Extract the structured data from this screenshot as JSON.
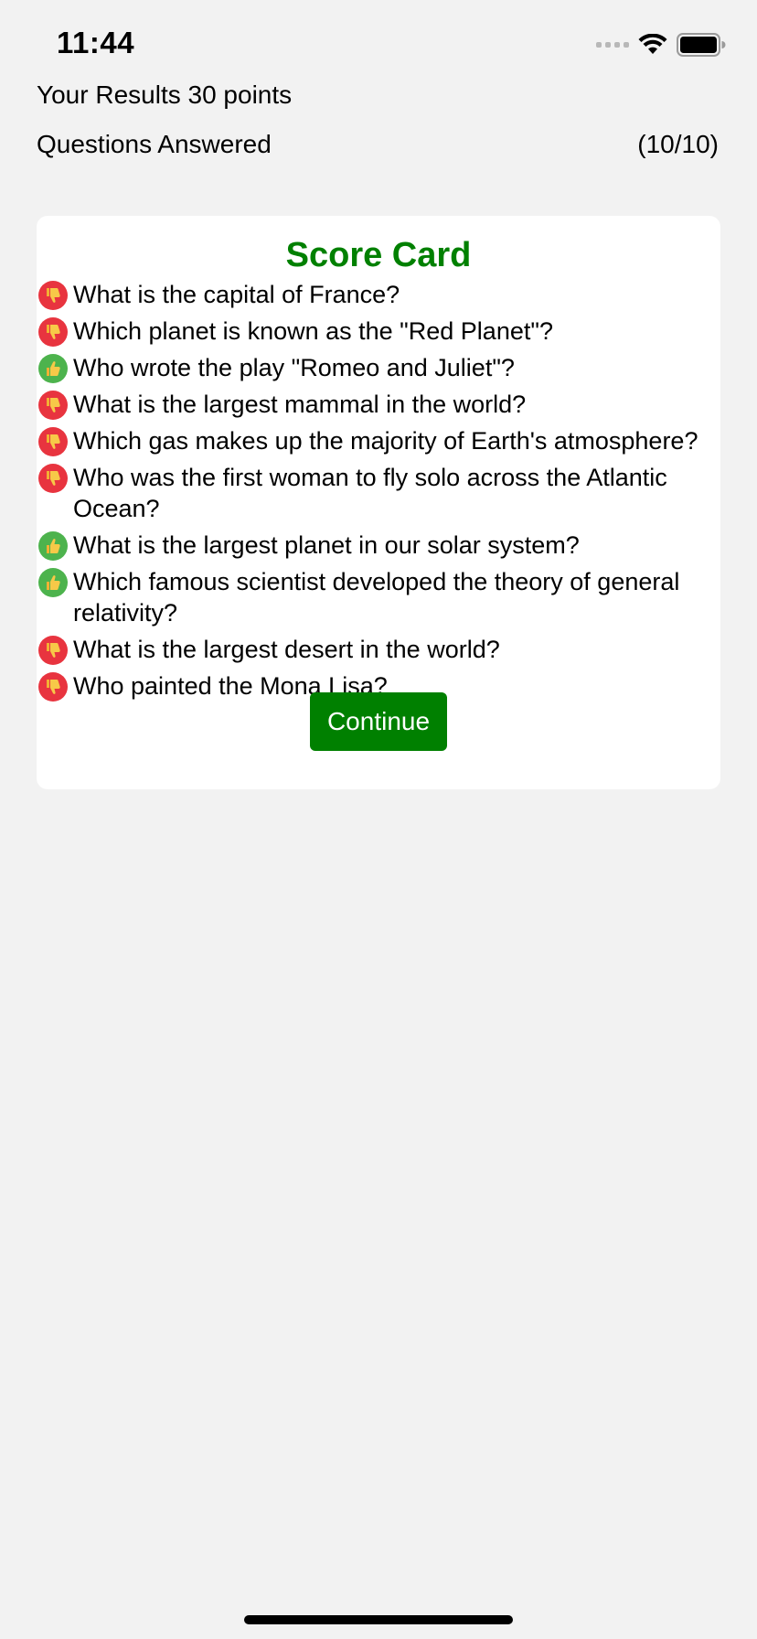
{
  "status_bar": {
    "time": "11:44"
  },
  "summary": {
    "results_text": "Your Results 30 points",
    "answered_label": "Questions Answered",
    "answered_count": "(10/10)"
  },
  "card": {
    "title": "Score Card",
    "title_color": "#008000",
    "questions": [
      {
        "text": "What is the capital of France?",
        "result": "wrong",
        "icon": "thumbs-down-icon"
      },
      {
        "text": "Which planet is known as the \"Red Planet\"?",
        "result": "wrong",
        "icon": "thumbs-down-icon"
      },
      {
        "text": "Who wrote the play \"Romeo and Juliet\"?",
        "result": "correct",
        "icon": "thumbs-up-icon"
      },
      {
        "text": "What is the largest mammal in the world?",
        "result": "wrong",
        "icon": "thumbs-down-icon"
      },
      {
        "text": "Which gas makes up the majority of Earth's atmosphere?",
        "result": "wrong",
        "icon": "thumbs-down-icon"
      },
      {
        "text": "Who was the first woman to fly solo across the Atlantic Ocean?",
        "result": "wrong",
        "icon": "thumbs-down-icon"
      },
      {
        "text": "What is the largest planet in our solar system?",
        "result": "correct",
        "icon": "thumbs-up-icon"
      },
      {
        "text": "Which famous scientist developed the theory of general relativity?",
        "result": "correct",
        "icon": "thumbs-up-icon"
      },
      {
        "text": "What is the largest desert in the world?",
        "result": "wrong",
        "icon": "thumbs-down-icon"
      },
      {
        "text": "Who painted the Mona Lisa?",
        "result": "wrong",
        "icon": "thumbs-down-icon"
      }
    ],
    "continue_label": "Continue",
    "button_color": "#008000"
  },
  "colors": {
    "wrong": "#e8343f",
    "correct": "#4db34d",
    "background": "#f2f2f2"
  }
}
